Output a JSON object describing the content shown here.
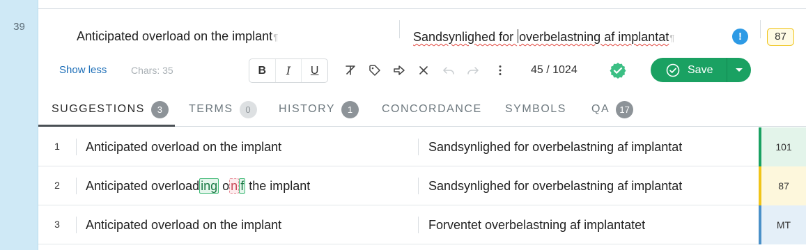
{
  "segment": {
    "number": "39",
    "source": "Anticipated overload on the implant",
    "target": {
      "before_caret": "Sandsynlighed for ",
      "after_caret": "overbelastning af implantat"
    },
    "pilcrow": "¶",
    "alert": "!",
    "match_score": "87"
  },
  "toolbar": {
    "show_less": "Show less",
    "chars": "Chars: 35",
    "bold": "B",
    "italic": "I",
    "underline": "U",
    "counter": "45 / 1024",
    "save_label": "Save"
  },
  "tabs": [
    {
      "label": "SUGGESTIONS",
      "count": "3"
    },
    {
      "label": "TERMS",
      "count": "0"
    },
    {
      "label": "HISTORY",
      "count": "1"
    },
    {
      "label": "CONCORDANCE"
    },
    {
      "label": "SYMBOLS"
    },
    {
      "label": "QA",
      "count": "17"
    }
  ],
  "suggestions": [
    {
      "num": "1",
      "source": "Anticipated overload on the implant",
      "target": "Sandsynlighed for overbelastning af implantat",
      "score": "101",
      "score_color": "#1aa162",
      "score_bg": "#e3f4ea"
    },
    {
      "num": "2",
      "source_parts": {
        "a": "Anticipated overloa",
        "b": "d",
        "ins1": "ing",
        "c": " o",
        "del1": "n",
        "ins2": "f",
        "d": " the implant"
      },
      "target": "Sandsynlighed for overbelastning af implantat",
      "score": "87",
      "score_color": "#f0c419",
      "score_bg": "#fdf7dc"
    },
    {
      "num": "3",
      "source": "Anticipated overload on the implant",
      "target": "Forventet overbelastning af implantatet",
      "score": "MT",
      "score_color": "#4a90c8",
      "score_bg": "#e4eff8"
    }
  ],
  "colors": {
    "accent": "#1aa162",
    "gutter": "#cfe9f6",
    "link": "#1e6fb8"
  }
}
